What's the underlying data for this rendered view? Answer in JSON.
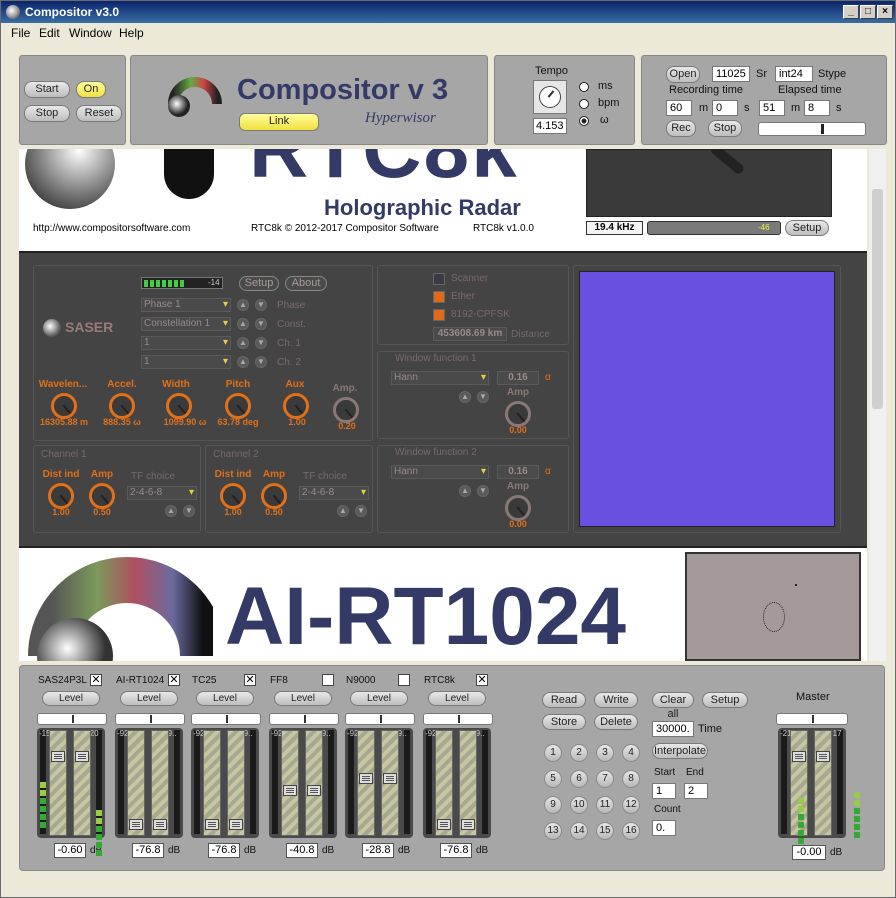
{
  "window": {
    "title": "Compositor v3.0"
  },
  "menu": [
    "File",
    "Edit",
    "Window",
    "Help"
  ],
  "transport": {
    "start": "Start",
    "on": "On",
    "stop": "Stop",
    "reset": "Reset"
  },
  "brand": {
    "title": "Compositor v 3",
    "subtitle": "Hyperwisor",
    "link": "Link"
  },
  "tempo": {
    "label": "Tempo",
    "value": "4.153",
    "options": [
      "ms",
      "bpm",
      "ω"
    ],
    "selected": "ω"
  },
  "recording": {
    "open": "Open",
    "sr_value": "11025",
    "sr_label": "Sr",
    "stype_value": "int24",
    "stype_label": "Stype",
    "rec_time_label": "Recording time",
    "elapsed_label": "Elapsed time",
    "rec_m": "60",
    "m1": "m",
    "rec_s": "0",
    "s1": "s",
    "el_m": "51",
    "m2": "m",
    "el_s": "8",
    "s2": "s",
    "rec": "Rec",
    "stop": "Stop"
  },
  "rtc8k": {
    "logo_text": "RTC8k",
    "subtitle": "Holographic Radar",
    "url": "http://www.compositorsoftware.com",
    "copyright": "RTC8k © 2012-2017 Compositor Software",
    "version": "RTC8k v1.0.0",
    "freq": "19.4 kHz",
    "level": "-46",
    "setup": "Setup"
  },
  "saser": {
    "logo": "SASER",
    "meter_val": "-14",
    "setup": "Setup",
    "about": "About",
    "selects": [
      {
        "value": "Phase 1",
        "label": "Phase"
      },
      {
        "value": "Constellation 1",
        "label": "Const."
      },
      {
        "value": "1",
        "label": "Ch. 1"
      },
      {
        "value": "1",
        "label": "Ch. 2"
      }
    ],
    "knobs": [
      {
        "label": "Wavelen...",
        "value": "16305.88 m"
      },
      {
        "label": "Accel.",
        "value": "888.35 ω"
      },
      {
        "label": "Width",
        "value": "1099.90 ω"
      },
      {
        "label": "Pitch",
        "value": "63.78 deg"
      },
      {
        "label": "Aux",
        "value": "1.00"
      },
      {
        "label": "Amp.",
        "value": "0.20"
      }
    ],
    "modes": [
      {
        "label": "Scanner",
        "on": false
      },
      {
        "label": "Ether",
        "on": true
      },
      {
        "label": "8192-CPFSK",
        "on": true
      }
    ],
    "distance_value": "453608.69 km",
    "distance_label": "Distance",
    "channels": [
      {
        "title": "Channel 1",
        "dist_label": "Dist ind",
        "dist": "1.00",
        "amp_label": "Amp",
        "amp": "0.50",
        "tf_label": "TF choice",
        "tf": "2-4-6-8"
      },
      {
        "title": "Channel 2",
        "dist_label": "Dist ind",
        "dist": "1.00",
        "amp_label": "Amp",
        "amp": "0.50",
        "tf_label": "TF choice",
        "tf": "2-4-6-8"
      }
    ],
    "windows": [
      {
        "title": "Window function 1",
        "type": "Hann",
        "alpha": "0.16",
        "alpha_label": "α",
        "amp_label": "Amp",
        "amp": "0.00"
      },
      {
        "title": "Window function 2",
        "type": "Hann",
        "alpha": "0.16",
        "alpha_label": "α",
        "amp_label": "Amp",
        "amp": "0.00"
      }
    ],
    "display_color": "#6a50e0"
  },
  "airt": {
    "logo_text": "AI-RT1024"
  },
  "mixer": {
    "channels": [
      {
        "name": "SAS24P3L",
        "checked": true,
        "level": "Level",
        "m1": "-15",
        "m2": "-20",
        "db": "-0.60"
      },
      {
        "name": "AI-RT1024",
        "checked": true,
        "level": "Level",
        "m1": "-92.",
        "m2": "-9..",
        "db": "-76.8"
      },
      {
        "name": "TC25",
        "checked": true,
        "level": "Level",
        "m1": "-92.",
        "m2": "-9..",
        "db": "-76.8"
      },
      {
        "name": "FF8",
        "checked": false,
        "level": "Level",
        "m1": "-92.",
        "m2": "-9..",
        "db": "-40.8"
      },
      {
        "name": "N9000",
        "checked": false,
        "level": "Level",
        "m1": "-92.",
        "m2": "-9..",
        "db": "-28.8"
      },
      {
        "name": "RTC8k",
        "checked": true,
        "level": "Level",
        "m1": "-92.",
        "m2": "-9..",
        "db": "-76.8"
      }
    ],
    "db_unit": "dB",
    "preset": {
      "read": "Read",
      "write": "Write",
      "store": "Store",
      "delete": "Delete",
      "clear_all": "Clear all",
      "setup": "Setup",
      "time_value": "30000.",
      "time_label": "Time",
      "interpolate": "Interpolate",
      "start_label": "Start",
      "end_label": "End",
      "start": "1",
      "end": "2",
      "count_label": "Count",
      "count": "0.",
      "slots": [
        "1",
        "2",
        "3",
        "4",
        "5",
        "6",
        "7",
        "8",
        "9",
        "10",
        "11",
        "12",
        "13",
        "14",
        "15",
        "16"
      ]
    },
    "master": {
      "label": "Master",
      "m1": "-21",
      "m2": "-17",
      "db": "-0.00"
    }
  }
}
